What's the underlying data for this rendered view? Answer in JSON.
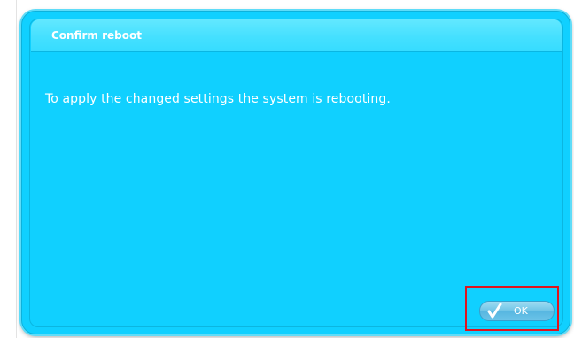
{
  "dialog": {
    "title": "Confirm reboot",
    "message": "To apply the changed settings the system is rebooting.",
    "ok_label": "OK"
  },
  "icons": {
    "ok_button_icon": "check-icon"
  },
  "colors": {
    "dialog_background": "#10d0ff",
    "title_bar": "#45e0ff",
    "text": "#ffffff",
    "highlight_border": "#e0141e"
  }
}
